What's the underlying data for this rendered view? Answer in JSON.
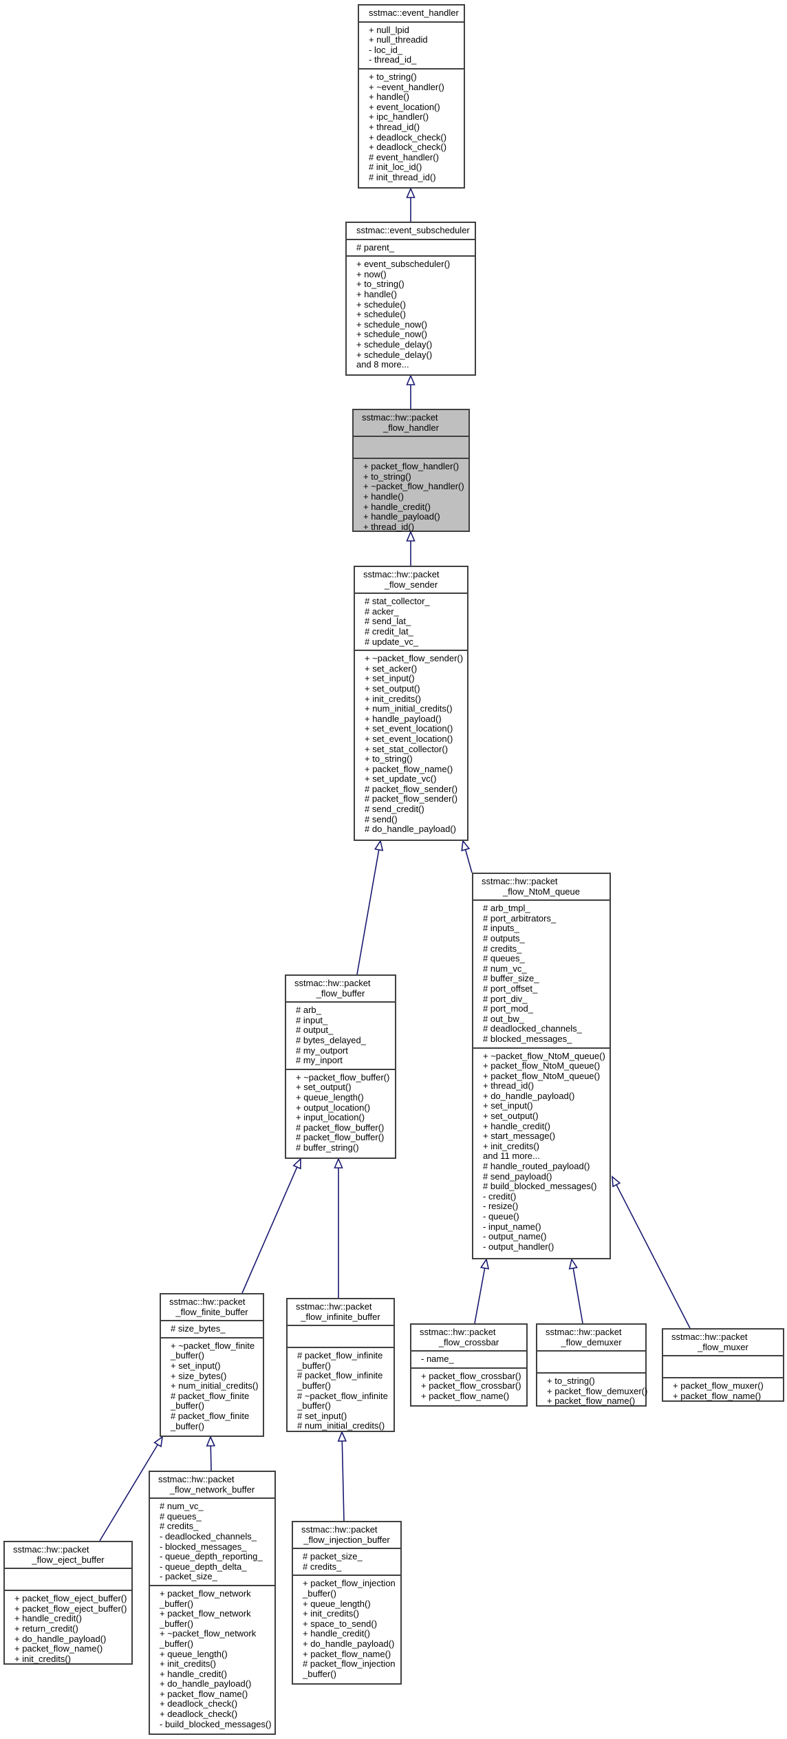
{
  "colors": {
    "edge": "#191970",
    "border": "#404040",
    "highlight": "#bfbfbf"
  },
  "classes": {
    "event_handler": {
      "title": [
        "sstmac::event_handler"
      ],
      "attributes": [
        "+ null_lpid",
        "+ null_threadid",
        "- loc_id_",
        "- thread_id_"
      ],
      "methods": [
        "+ to_string()",
        "+ ~event_handler()",
        "+ handle()",
        "+ event_location()",
        "+ ipc_handler()",
        "+ thread_id()",
        "+ deadlock_check()",
        "+ deadlock_check()",
        "# event_handler()",
        "# init_loc_id()",
        "# init_thread_id()"
      ]
    },
    "event_subscheduler": {
      "title": [
        "sstmac::event_subscheduler"
      ],
      "attributes": [
        "# parent_"
      ],
      "methods": [
        "+ event_subscheduler()",
        "+ now()",
        "+ to_string()",
        "+ handle()",
        "+ schedule()",
        "+ schedule()",
        "+ schedule_now()",
        "+ schedule_now()",
        "+ schedule_delay()",
        "+ schedule_delay()",
        "and 8 more..."
      ]
    },
    "packet_flow_handler": {
      "title": [
        "sstmac::hw::packet",
        "_flow_handler"
      ],
      "attributes": [],
      "methods": [
        "+ packet_flow_handler()",
        "+ to_string()",
        "+ ~packet_flow_handler()",
        "+ handle()",
        "+ handle_credit()",
        "+ handle_payload()",
        "+ thread_id()"
      ]
    },
    "packet_flow_sender": {
      "title": [
        "sstmac::hw::packet",
        "_flow_sender"
      ],
      "attributes": [
        "# stat_collector_",
        "# acker_",
        "# send_lat_",
        "# credit_lat_",
        "# update_vc_"
      ],
      "methods": [
        "+ ~packet_flow_sender()",
        "+ set_acker()",
        "+ set_input()",
        "+ set_output()",
        "+ init_credits()",
        "+ num_initial_credits()",
        "+ handle_payload()",
        "+ set_event_location()",
        "+ set_event_location()",
        "+ set_stat_collector()",
        "+ to_string()",
        "+ packet_flow_name()",
        "+ set_update_vc()",
        "# packet_flow_sender()",
        "# packet_flow_sender()",
        "# send_credit()",
        "# send()",
        "# do_handle_payload()"
      ]
    },
    "packet_flow_NtoM_queue": {
      "title": [
        "sstmac::hw::packet",
        "_flow_NtoM_queue"
      ],
      "attributes": [
        "# arb_tmpl_",
        "# port_arbitrators_",
        "# inputs_",
        "# outputs_",
        "# credits_",
        "# queues_",
        "# num_vc_",
        "# buffer_size_",
        "# port_offset_",
        "# port_div_",
        "# port_mod_",
        "# out_bw_",
        "# deadlocked_channels_",
        "# blocked_messages_"
      ],
      "methods": [
        "+ ~packet_flow_NtoM_queue()",
        "+ packet_flow_NtoM_queue()",
        "+ packet_flow_NtoM_queue()",
        "+ thread_id()",
        "+ do_handle_payload()",
        "+ set_input()",
        "+ set_output()",
        "+ handle_credit()",
        "+ start_message()",
        "+ init_credits()",
        "and 11 more...",
        "# handle_routed_payload()",
        "# send_payload()",
        "# build_blocked_messages()",
        "- credit()",
        "- resize()",
        "- queue()",
        "- input_name()",
        "- output_name()",
        "- output_handler()"
      ]
    },
    "packet_flow_buffer": {
      "title": [
        "sstmac::hw::packet",
        "_flow_buffer"
      ],
      "attributes": [
        "# arb_",
        "# input_",
        "# output_",
        "# bytes_delayed_",
        "# my_outport",
        "# my_inport"
      ],
      "methods": [
        "+ ~packet_flow_buffer()",
        "+ set_output()",
        "+ queue_length()",
        "+ output_location()",
        "+ input_location()",
        "# packet_flow_buffer()",
        "# packet_flow_buffer()",
        "# buffer_string()"
      ]
    },
    "packet_flow_finite_buffer": {
      "title": [
        "sstmac::hw::packet",
        "_flow_finite_buffer"
      ],
      "attributes": [
        "# size_bytes_"
      ],
      "methods": [
        "+ ~packet_flow_finite",
        "_buffer()",
        "+ set_input()",
        "+ size_bytes()",
        "+ num_initial_credits()",
        "# packet_flow_finite",
        "_buffer()",
        "# packet_flow_finite",
        "_buffer()"
      ]
    },
    "packet_flow_infinite_buffer": {
      "title": [
        "sstmac::hw::packet",
        "_flow_infinite_buffer"
      ],
      "attributes": [],
      "methods": [
        "# packet_flow_infinite",
        "_buffer()",
        "# packet_flow_infinite",
        "_buffer()",
        "# ~packet_flow_infinite",
        "_buffer()",
        "# set_input()",
        "# num_initial_credits()"
      ]
    },
    "packet_flow_crossbar": {
      "title": [
        "sstmac::hw::packet",
        "_flow_crossbar"
      ],
      "attributes": [
        "- name_"
      ],
      "methods": [
        "+ packet_flow_crossbar()",
        "+ packet_flow_crossbar()",
        "+ packet_flow_name()"
      ]
    },
    "packet_flow_demuxer": {
      "title": [
        "sstmac::hw::packet",
        "_flow_demuxer"
      ],
      "attributes": [],
      "methods": [
        "+ to_string()",
        "+ packet_flow_demuxer()",
        "+ packet_flow_name()"
      ]
    },
    "packet_flow_muxer": {
      "title": [
        "sstmac::hw::packet",
        "_flow_muxer"
      ],
      "attributes": [],
      "methods": [
        "+ packet_flow_muxer()",
        "+ packet_flow_name()"
      ]
    },
    "packet_flow_eject_buffer": {
      "title": [
        "sstmac::hw::packet",
        "_flow_eject_buffer"
      ],
      "attributes": [],
      "methods": [
        "+ packet_flow_eject_buffer()",
        "+ packet_flow_eject_buffer()",
        "+ handle_credit()",
        "+ return_credit()",
        "+ do_handle_payload()",
        "+ packet_flow_name()",
        "+ init_credits()"
      ]
    },
    "packet_flow_network_buffer": {
      "title": [
        "sstmac::hw::packet",
        "_flow_network_buffer"
      ],
      "attributes": [
        "# num_vc_",
        "# queues_",
        "# credits_",
        "- deadlocked_channels_",
        "- blocked_messages_",
        "- queue_depth_reporting_",
        "- queue_depth_delta_",
        "- packet_size_"
      ],
      "methods": [
        "+ packet_flow_network",
        "_buffer()",
        "+ packet_flow_network",
        "_buffer()",
        "+ ~packet_flow_network",
        "_buffer()",
        "+ queue_length()",
        "+ init_credits()",
        "+ handle_credit()",
        "+ do_handle_payload()",
        "+ packet_flow_name()",
        "+ deadlock_check()",
        "+ deadlock_check()",
        "- build_blocked_messages()"
      ]
    },
    "packet_flow_injection_buffer": {
      "title": [
        "sstmac::hw::packet",
        "_flow_injection_buffer"
      ],
      "attributes": [
        "# packet_size_",
        "# credits_"
      ],
      "methods": [
        "+ packet_flow_injection",
        "_buffer()",
        "+ queue_length()",
        "+ init_credits()",
        "+ space_to_send()",
        "+ handle_credit()",
        "+ do_handle_payload()",
        "+ packet_flow_name()",
        "# packet_flow_injection",
        "_buffer()"
      ]
    }
  },
  "current_class": "packet_flow_handler",
  "inheritance": [
    {
      "child": "event_subscheduler",
      "parent": "event_handler"
    },
    {
      "child": "packet_flow_handler",
      "parent": "event_subscheduler"
    },
    {
      "child": "packet_flow_sender",
      "parent": "packet_flow_handler"
    },
    {
      "child": "packet_flow_buffer",
      "parent": "packet_flow_sender"
    },
    {
      "child": "packet_flow_NtoM_queue",
      "parent": "packet_flow_sender"
    },
    {
      "child": "packet_flow_finite_buffer",
      "parent": "packet_flow_buffer"
    },
    {
      "child": "packet_flow_infinite_buffer",
      "parent": "packet_flow_buffer"
    },
    {
      "child": "packet_flow_crossbar",
      "parent": "packet_flow_NtoM_queue"
    },
    {
      "child": "packet_flow_demuxer",
      "parent": "packet_flow_NtoM_queue"
    },
    {
      "child": "packet_flow_muxer",
      "parent": "packet_flow_NtoM_queue"
    },
    {
      "child": "packet_flow_eject_buffer",
      "parent": "packet_flow_finite_buffer"
    },
    {
      "child": "packet_flow_network_buffer",
      "parent": "packet_flow_finite_buffer"
    },
    {
      "child": "packet_flow_injection_buffer",
      "parent": "packet_flow_infinite_buffer"
    }
  ]
}
